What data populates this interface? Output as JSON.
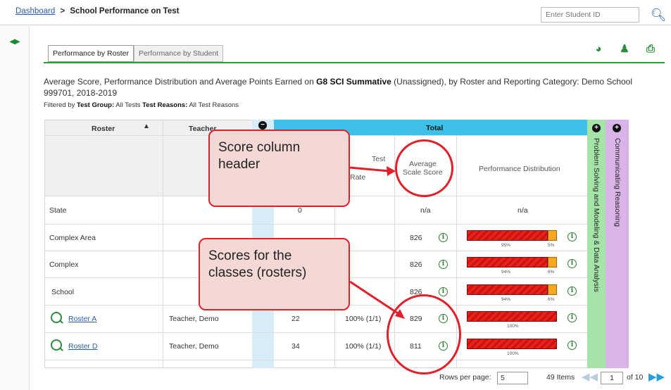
{
  "breadcrumb": {
    "home": "Dashboard",
    "separator": ">",
    "current": "School Performance on Test"
  },
  "search": {
    "placeholder": "Enter Student ID",
    "icon": "search-icon"
  },
  "tabs": [
    {
      "label": "Performance by Roster"
    },
    {
      "label": "Performance by Student"
    }
  ],
  "description": {
    "prefix": "Average Score, Performance Distribution and Average Points Earned on ",
    "test": "G8 SCI Summative",
    "suffix": " (Unassigned), by Roster and Reporting Category: Demo School 999701, 2018-2019"
  },
  "filter": {
    "label1": "Filtered by",
    "group_label": "Test Group:",
    "group_value": "All Tests",
    "reason_label": "Test Reasons:",
    "reason_value": "All Test Reasons"
  },
  "table": {
    "headers": {
      "roster": "Roster",
      "teacher": "Teacher",
      "total": "Total",
      "test_label": "Test",
      "rate_partial": "Rate",
      "avg_line1": "Average",
      "avg_line2": "Scale Score",
      "dist": "Performance Distribution",
      "cat1": "Problem Solving and Modeling & Data Analysis",
      "cat2": "Communicating Reasoning"
    },
    "rows": [
      {
        "name": "State",
        "teacher": "",
        "count": "0",
        "rate": "",
        "score": "n/a",
        "dist": "n/a"
      },
      {
        "name": "Complex Area",
        "teacher": "",
        "count": "",
        "rate": "",
        "score": "826",
        "p1": "95%",
        "p2": "5%"
      },
      {
        "name": "Complex",
        "teacher": "",
        "count": "",
        "rate": "",
        "score": "826",
        "p1": "94%",
        "p2": "6%"
      },
      {
        "name": "School",
        "teacher": "",
        "count": "",
        "rate": "",
        "score": "826",
        "p1": "94%",
        "p2": "6%"
      },
      {
        "name": "Roster A",
        "teacher": "Teacher, Demo",
        "count": "22",
        "rate": "100% (1/1)",
        "score": "829",
        "p1": "100%"
      },
      {
        "name": "Roster D",
        "teacher": "Teacher, Demo",
        "count": "34",
        "rate": "100% (1/1)",
        "score": "811",
        "p1": "100%"
      }
    ]
  },
  "callouts": {
    "score_header_line1": "Score column",
    "score_header_line2": "header",
    "scores_line1": "Scores for the",
    "scores_line2": "classes (rosters)"
  },
  "pager": {
    "rows_label": "Rows per page:",
    "rows_value": "5",
    "items": "49 Items",
    "page": "1",
    "of": "of 10"
  },
  "colors": {
    "accent_green": "#2e9b3e",
    "total_band": "#3ec1e8",
    "callout_red": "#e0202a"
  }
}
